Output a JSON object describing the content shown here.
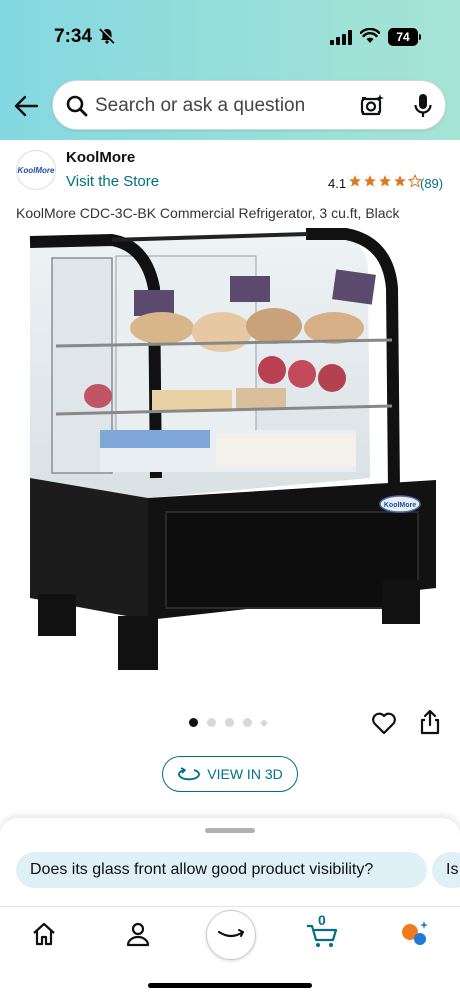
{
  "status_bar": {
    "time": "7:34",
    "battery": "74"
  },
  "search": {
    "placeholder": "Search or ask a question"
  },
  "product": {
    "brand": "KoolMore",
    "brand_logo_text": "KoolMore",
    "visit_store": "Visit the Store",
    "rating": "4.1",
    "rating_value": 4.1,
    "rating_count": "(89)",
    "title": "KoolMore CDC-3C-BK Commercial Refrigerator, 3 cu.ft, Black",
    "image_badge": "KoolMore",
    "image_count": 5,
    "active_image": 0
  },
  "view3d": {
    "label": "VIEW IN 3D"
  },
  "sheet": {
    "chips": [
      "Does its glass front allow good product visibility?",
      "Is"
    ]
  },
  "nav": {
    "cart_count": "0"
  },
  "colors": {
    "header_start": "#84d8e1",
    "header_end": "#a6e4d4",
    "link": "#007185",
    "star": "#de7921",
    "chip_bg": "#dff0f7"
  }
}
